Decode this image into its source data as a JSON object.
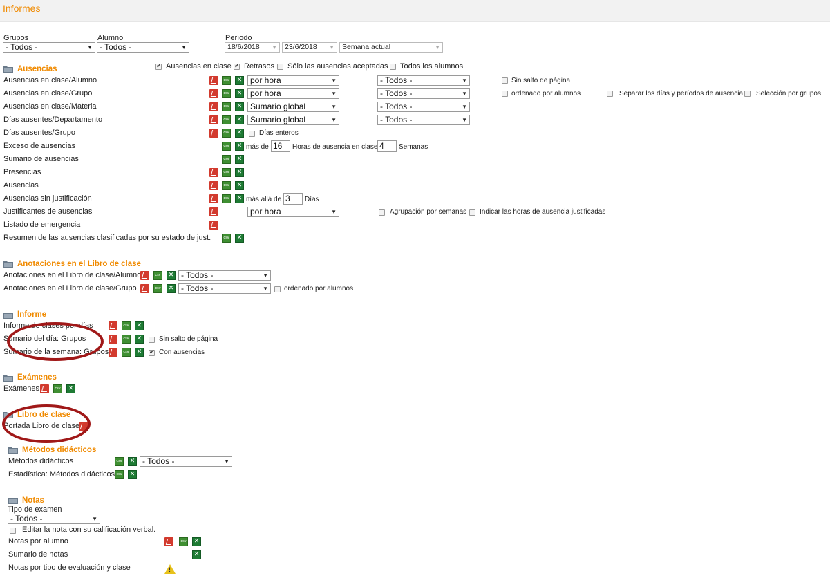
{
  "app": {
    "title": "Informes"
  },
  "filters": {
    "grupos_label": "Grupos",
    "grupos_value": "- Todos -",
    "alumno_label": "Alumno",
    "alumno_value": "- Todos -",
    "periodo_label": "Período",
    "fecha_desde": "18/6/2018",
    "fecha_hasta": "23/6/2018",
    "periodo_value": "Semana actual"
  },
  "ausencias": {
    "title": "Ausencias",
    "opt_en_clase": "Ausencias en clase",
    "opt_retrasos": "Retrasos",
    "opt_aceptadas": "Sólo las ausencias aceptadas",
    "opt_todos_alumnos": "Todos los alumnos",
    "rows": {
      "r1": "Ausencias en clase/Alumno",
      "r2": "Ausencias en clase/Grupo",
      "r3": "Ausencias en clase/Materia",
      "r4": "Días ausentes/Departamento",
      "r5": "Días ausentes/Grupo",
      "r6": "Exceso de ausencias",
      "r7": "Sumario de ausencias",
      "r8": "Presencias",
      "r9": "Ausencias",
      "r10": "Ausencias sin justificación",
      "r11": "Justificantes de ausencias",
      "r12": "Listado de emergencia",
      "r13": "Resumen de las ausencias clasificadas por su estado de just."
    },
    "sel_por_hora": "por hora",
    "sel_sumario_global": "Sumario global",
    "sel_todos": "- Todos -",
    "sin_salto": "Sin salto de página",
    "ordenado_alumnos": "ordenado por alumnos",
    "separar_dias": "Separar los días y períodos de ausencia",
    "seleccion_grupos": "Selección por grupos",
    "dias_enteros": "Días enteros",
    "mas_de": "más de",
    "horas_value": "16",
    "horas_label": "Horas de ausencia en clase",
    "semanas_value": "4",
    "semanas_label": "Semanas",
    "mas_alla_de": "más allá de",
    "dias_value": "3",
    "dias_label": "Días",
    "agrupacion_semanas": "Agrupación por semanas",
    "indicar_horas": "Indicar las horas de ausencia justificadas"
  },
  "anotaciones": {
    "title": "Anotaciones en el Libro de clase",
    "r1": "Anotaciones en el Libro de clase/Alumno",
    "r2": "Anotaciones en el Libro de clase/Grupo",
    "sel": "- Todos -",
    "ordenado_alumnos": "ordenado por alumnos"
  },
  "informe": {
    "title": "Informe",
    "r1": "Informe de clases por días",
    "r2": "Sumario del día: Grupos",
    "r3": "Sumario de la semana: Grupos",
    "sin_salto": "Sin salto de página",
    "con_ausencias": "Con ausencias"
  },
  "examenes": {
    "title": "Exámenes",
    "r1": "Exámenes"
  },
  "libro": {
    "title": "Libro de clase",
    "r1": "Portada Libro de clase"
  },
  "metodos": {
    "title": "Métodos didácticos",
    "r1": "Métodos didácticos",
    "r2": "Estadística: Métodos didácticos",
    "sel": "- Todos -"
  },
  "notas": {
    "title": "Notas",
    "tipo_examen_label": "Tipo de examen",
    "tipo_examen_value": "- Todos -",
    "editar_nota": "Editar la nota con su calificación verbal.",
    "r1": "Notas por alumno",
    "r2": "Sumario de notas",
    "r3": "Notas por tipo de evaluación y clase"
  },
  "colors": {
    "accent": "#f08a00",
    "annotation_ring": "#a01818"
  }
}
